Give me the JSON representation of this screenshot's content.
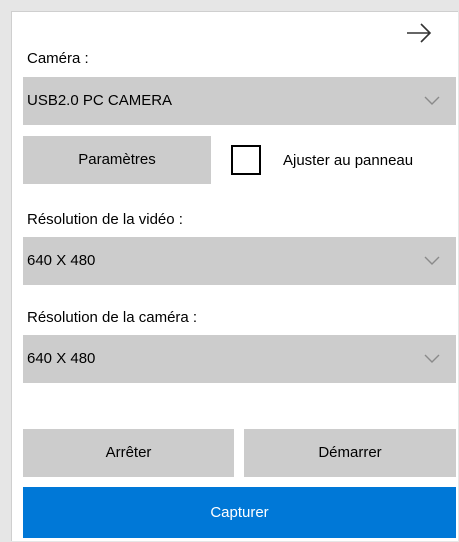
{
  "header": {
    "forward_icon": "arrow-right-icon"
  },
  "camera": {
    "label": "Caméra :",
    "selected": "USB2.0 PC CAMERA",
    "chevron_icon": "chevron-down-icon"
  },
  "settings": {
    "parameters_label": "Paramètres",
    "fit_label": "Ajuster au panneau",
    "fit_checked": false
  },
  "video_resolution": {
    "label": "Résolution de la vidéo :",
    "selected": "640 X 480"
  },
  "camera_resolution": {
    "label": "Résolution de la caméra :",
    "selected": "640 X 480"
  },
  "actions": {
    "stop_label": "Arrêter",
    "start_label": "Démarrer",
    "capture_label": "Capturer"
  },
  "colors": {
    "primary": "#0078d7",
    "control_bg": "#cccccc",
    "panel_bg": "#ffffff",
    "page_bg": "#e6e6e6"
  }
}
